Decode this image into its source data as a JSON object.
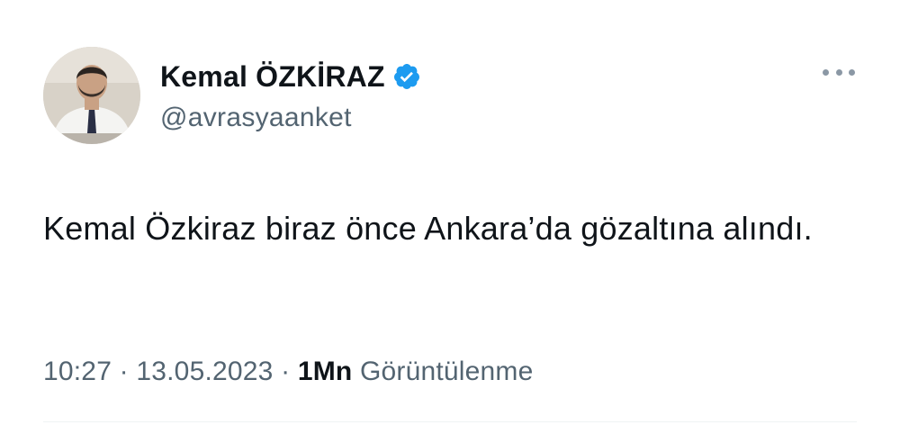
{
  "author": {
    "display_name": "Kemal ÖZKİRAZ",
    "handle": "@avrasyaanket",
    "verified": true,
    "verified_color": "#1d9bf0",
    "avatar_icon": "profile-photo"
  },
  "tweet": {
    "text": "Kemal Özkiraz biraz önce Ankara’da gözaltına alındı.",
    "time": "10:27",
    "date": "13.05.2023",
    "views_count": "1Mn",
    "views_label": "Görüntülenme",
    "separator": "·"
  },
  "icons": {
    "more": "more-options-icon",
    "verified": "verified-badge-icon"
  }
}
